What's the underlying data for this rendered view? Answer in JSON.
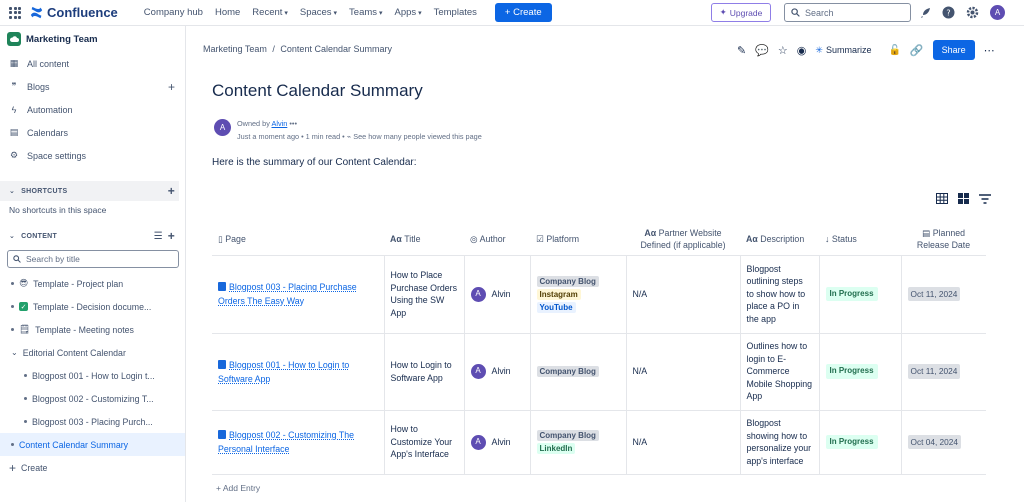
{
  "topbar": {
    "app_name": "Confluence",
    "nav": [
      "Company hub",
      "Home",
      "Recent",
      "Spaces",
      "Teams",
      "Apps",
      "Templates"
    ],
    "create_label": "Create",
    "upgrade_label": "Upgrade",
    "search_placeholder": "Search",
    "avatar_initial": "A"
  },
  "sidebar": {
    "space_name": "Marketing Team",
    "items": [
      "All content",
      "Blogs",
      "Automation",
      "Calendars",
      "Space settings"
    ],
    "shortcuts_header": "SHORTCUTS",
    "no_shortcuts": "No shortcuts in this space",
    "content_header": "CONTENT",
    "search_placeholder": "Search by title",
    "tree": [
      "Template - Project plan",
      "Template - Decision docume...",
      "Template - Meeting notes",
      "Editorial Content Calendar",
      "Blogpost 001 - How to Login t...",
      "Blogpost 002 - Customizing T...",
      "Blogpost 003 - Placing Purch...",
      "Content Calendar Summary"
    ],
    "create_label": "Create"
  },
  "page": {
    "breadcrumb_space": "Marketing Team",
    "breadcrumb_sep": "/",
    "breadcrumb_page": "Content Calendar Summary",
    "summarize_label": "Summarize",
    "share_label": "Share",
    "title": "Content Calendar Summary",
    "owned_by": "Owned by",
    "owner": "Alvin",
    "timestamp": "Just a moment ago",
    "read_time": "1 min read",
    "views_label": "See how many people viewed this page",
    "intro": "Here is the summary of our Content Calendar:",
    "add_entry": "+ Add Entry"
  },
  "table": {
    "headers": {
      "page": "Page",
      "title": "Title",
      "author": "Author",
      "platform": "Platform",
      "partner": "Partner Website Defined (if applicable)",
      "description": "Description",
      "status": "Status",
      "release": "Planned Release Date"
    },
    "rows": [
      {
        "page": "Blogpost 003 - Placing Purchase Orders The Easy Way",
        "title": "How to Place Purchase Orders Using the SW App",
        "author": "Alvin",
        "platform": [
          "Company Blog",
          "Instagram",
          "YouTube"
        ],
        "partner": "N/A",
        "description": "Blogpost outlining steps to show how to place a PO in the app",
        "status": "In Progress",
        "date": "Oct 11, 2024"
      },
      {
        "page": "Blogpost 001 - How to Login to Software App",
        "title": "How to Login to Software App",
        "author": "Alvin",
        "platform": [
          "Company Blog"
        ],
        "partner": "N/A",
        "description": "Outlines how to login to E-Commerce Mobile Shopping App",
        "status": "In Progress",
        "date": "Oct 11, 2024"
      },
      {
        "page": "Blogpost 002 - Customizing The Personal Interface",
        "title": "How to Customize Your App's Interface",
        "author": "Alvin",
        "platform": [
          "Company Blog",
          "LinkedIn"
        ],
        "partner": "N/A",
        "description": "Blogpost showing how to personalize your app's interface",
        "status": "In Progress",
        "date": "Oct 04, 2024"
      }
    ]
  },
  "colors": {
    "primary": "#0c66e4",
    "status_green": "#216e4e",
    "avatar": "#5e4db2"
  }
}
